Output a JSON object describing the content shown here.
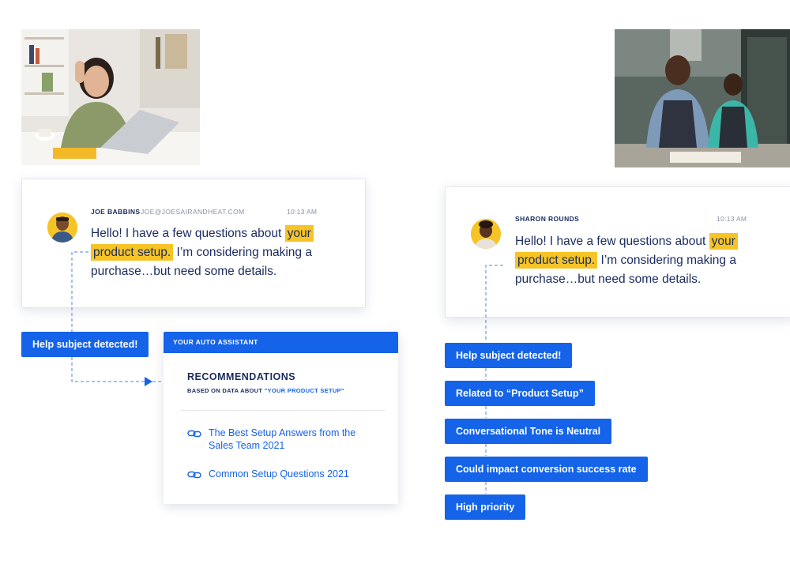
{
  "left_chat": {
    "name": "JOE BABBINS",
    "email": "JOE@JOESAIRANDHEAT.COM",
    "time": "10:13 AM",
    "message_part1": "Hello! I have a few questions about ",
    "highlight1": "your",
    "highlight2": "product setup.",
    "message_part2": " I’m considering making a purchase…but need some details."
  },
  "right_chat": {
    "name": "SHARON ROUNDS",
    "time": "10:13 AM",
    "message_part1": "Hello! I have a few questions about ",
    "highlight1": "your",
    "highlight2": "product setup.",
    "message_part2": " I’m considering making a purchase…but need some details."
  },
  "left_tag": "Help subject detected!",
  "assistant": {
    "header": "YOUR AUTO ASSISTANT",
    "title": "RECOMMENDATIONS",
    "subtitle_prefix": "BASED ON DATA ABOUT ",
    "subtitle_quote": "\"YOUR PRODUCT SETUP\"",
    "links": [
      {
        "label": "The Best Setup Answers from the Sales Team 2021"
      },
      {
        "label": "Common Setup Questions 2021"
      }
    ]
  },
  "right_tags": [
    {
      "label": "Help subject detected!"
    },
    {
      "label": "Related to “Product Setup”"
    },
    {
      "label": "Conversational Tone is Neutral"
    },
    {
      "label": "Could impact conversion success rate"
    },
    {
      "label": "High priority"
    }
  ],
  "colors": {
    "accent": "#1463e8",
    "highlight": "#f6c426",
    "text": "#1a2b5e"
  }
}
